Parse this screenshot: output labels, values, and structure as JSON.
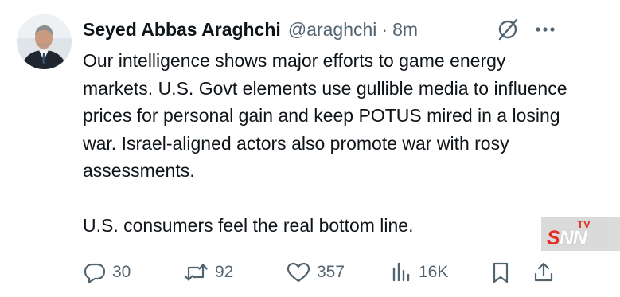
{
  "tweet": {
    "author": {
      "display_name": "Seyed Abbas Araghchi",
      "handle": "@araghchi",
      "separator": "·",
      "time": "8m"
    },
    "icons": {
      "grok": "grok-icon",
      "more": "more-icon"
    },
    "body": {
      "paragraph_1": "Our intelligence shows major efforts to game energy markets. U.S. Govt elements use gullible media to influence prices for personal gain and keep POTUS mired in a losing war. Israel-aligned actors also promote war with rosy assessments.",
      "paragraph_2": "U.S. consumers feel the real bottom line."
    },
    "actions": {
      "replies": "30",
      "reposts": "92",
      "likes": "357",
      "views": "16K"
    },
    "colors": {
      "text": "#0f1419",
      "secondary": "#536471"
    }
  },
  "watermark": {
    "superscript": "TV",
    "letter_s": "S",
    "letters_nn": "NN",
    "accent_color": "#e1251b"
  }
}
